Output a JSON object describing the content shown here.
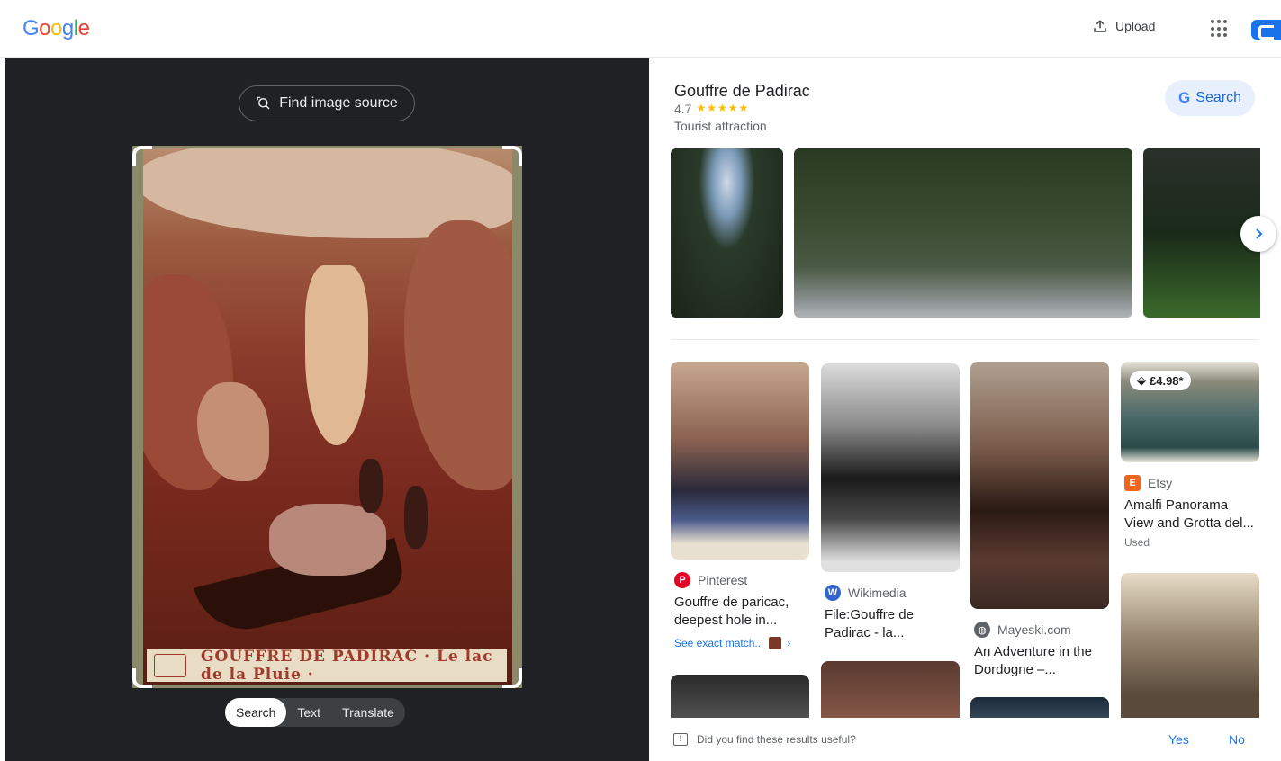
{
  "header": {
    "logo_letters": [
      "G",
      "o",
      "o",
      "g",
      "l",
      "e"
    ],
    "upload_label": "Upload",
    "upload_icon": "upload-icon",
    "apps_icon": "apps-grid-icon"
  },
  "left": {
    "find_source_label": "Find image source",
    "find_source_icon": "lens-search-icon",
    "caption_text": "GOUFFRE DE PADIRAC · Le lac de la Pluie ·",
    "modes": [
      {
        "label": "Search",
        "active": true
      },
      {
        "label": "Text",
        "active": false
      },
      {
        "label": "Translate",
        "active": false
      }
    ]
  },
  "knowledge": {
    "title": "Gouffre de Padirac",
    "rating": "4.7",
    "stars": "★★★★★",
    "rating_value": 4.7,
    "type": "Tourist attraction",
    "search_label": "Search",
    "next_icon": "chevron-right-icon"
  },
  "results": [
    {
      "source": "Pinterest",
      "title": "Gouffre de paricac, deepest hole in...",
      "extra": "See exact match...",
      "icon_color": "#e60023"
    },
    {
      "source": "Wikimedia",
      "title": "File:Gouffre de Padirac - la...",
      "icon_color": "#3366cc"
    },
    {
      "source": "Mayeski.com",
      "title": "An Adventure in the Dordogne –...",
      "icon_color": "#5f6368"
    },
    {
      "source": "Etsy",
      "title": "Amalfi Panorama View and Grotta del...",
      "price": "£4.98*",
      "status": "Used",
      "icon_color": "#f1641e"
    }
  ],
  "feedback": {
    "question": "Did you find these results useful?",
    "yes": "Yes",
    "no": "No"
  },
  "colors": {
    "accent": "#1a73e8",
    "dark_pane": "#202124"
  }
}
